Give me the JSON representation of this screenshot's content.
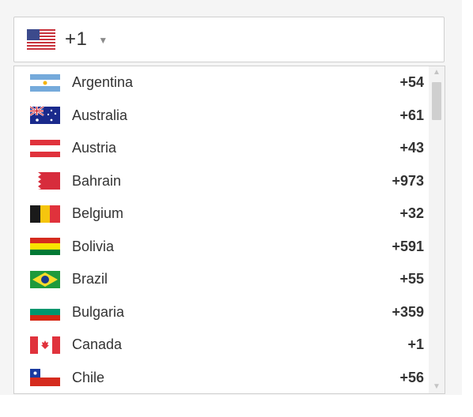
{
  "selector": {
    "flag_icon": "us-flag-icon",
    "code": "+1",
    "caret_icon": "caret-down-icon"
  },
  "countries": [
    {
      "name": "Argentina",
      "dial": "+54",
      "flag": "argentina-flag-icon"
    },
    {
      "name": "Australia",
      "dial": "+61",
      "flag": "australia-flag-icon"
    },
    {
      "name": "Austria",
      "dial": "+43",
      "flag": "austria-flag-icon"
    },
    {
      "name": "Bahrain",
      "dial": "+973",
      "flag": "bahrain-flag-icon"
    },
    {
      "name": "Belgium",
      "dial": "+32",
      "flag": "belgium-flag-icon"
    },
    {
      "name": "Bolivia",
      "dial": "+591",
      "flag": "bolivia-flag-icon"
    },
    {
      "name": "Brazil",
      "dial": "+55",
      "flag": "brazil-flag-icon"
    },
    {
      "name": "Bulgaria",
      "dial": "+359",
      "flag": "bulgaria-flag-icon"
    },
    {
      "name": "Canada",
      "dial": "+1",
      "flag": "canada-flag-icon"
    },
    {
      "name": "Chile",
      "dial": "+56",
      "flag": "chile-flag-icon"
    }
  ],
  "scrollbar": {
    "up_icon": "scroll-up-arrow-icon",
    "down_icon": "scroll-down-arrow-icon"
  }
}
